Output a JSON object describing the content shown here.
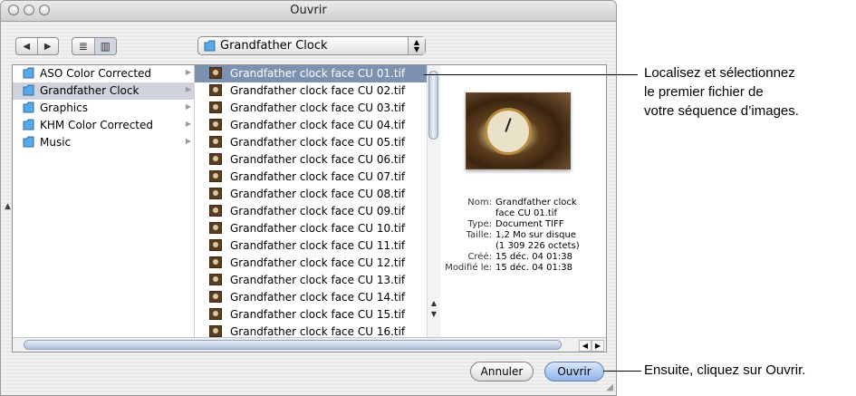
{
  "window": {
    "title": "Ouvrir"
  },
  "toolbar": {
    "back": "◀",
    "forward": "▶",
    "view_list": "≣",
    "view_columns": "▥"
  },
  "location": {
    "folder": "Grandfather Clock",
    "arrows_up": "▲",
    "arrows_down": "▼"
  },
  "sidebar": {
    "items": [
      {
        "label": "ASO Color Corrected",
        "selected": false
      },
      {
        "label": "Grandfather Clock",
        "selected": true
      },
      {
        "label": "Graphics",
        "selected": false
      },
      {
        "label": "KHM Color Corrected",
        "selected": false
      },
      {
        "label": "Music",
        "selected": false
      }
    ]
  },
  "files": {
    "items": [
      "Grandfather clock face CU 01.tif",
      "Grandfather clock face CU 02.tif",
      "Grandfather clock face CU 03.tif",
      "Grandfather clock face CU 04.tif",
      "Grandfather clock face CU 05.tif",
      "Grandfather clock face CU 06.tif",
      "Grandfather clock face CU 07.tif",
      "Grandfather clock face CU 08.tif",
      "Grandfather clock face CU 09.tif",
      "Grandfather clock face CU 10.tif",
      "Grandfather clock face CU 11.tif",
      "Grandfather clock face CU 12.tif",
      "Grandfather clock face CU 13.tif",
      "Grandfather clock face CU 14.tif",
      "Grandfather clock face CU 15.tif",
      "Grandfather clock face CU 16.tif"
    ],
    "selected_index": 0
  },
  "preview": {
    "name_label": "Nom:",
    "name_value_1": "Grandfather clock",
    "name_value_2": "face CU 01.tif",
    "type_label": "Type:",
    "type_value": "Document TIFF",
    "size_label": "Taille:",
    "size_value_1": "1,2 Mo sur disque",
    "size_value_2": "(1 309 226 octets)",
    "created_label": "Créé:",
    "created_value": "15 déc. 04 01:38",
    "modified_label": "Modifié le:",
    "modified_value": "15 déc. 04 01:38"
  },
  "buttons": {
    "cancel": "Annuler",
    "open": "Ouvrir"
  },
  "callouts": {
    "top_line_1": "Localisez et sélectionnez",
    "top_line_2": "le premier fichier de",
    "top_line_3": "votre séquence d’images.",
    "bottom": "Ensuite, cliquez sur Ouvrir."
  },
  "colors": {
    "selection": "#7d92b0",
    "folder": "#5aa9e6",
    "default_button": "#8fb4e8"
  }
}
